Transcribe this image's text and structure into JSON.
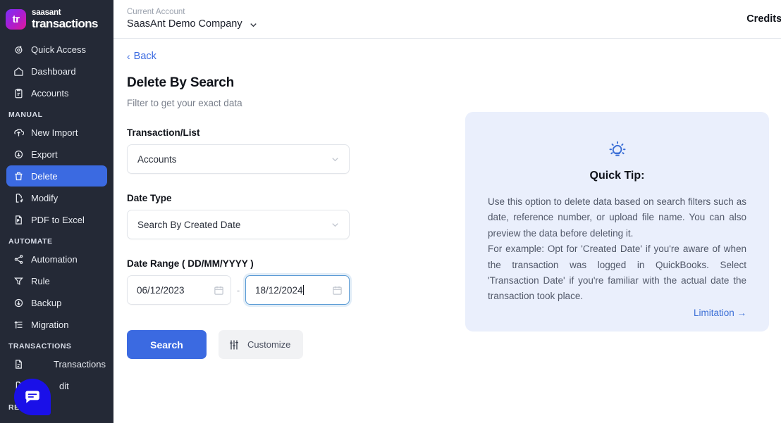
{
  "brand": {
    "mark_text": "tr",
    "name_top": "saasant",
    "name_bottom": "transactions"
  },
  "header": {
    "account_label": "Current Account",
    "account_name": "SaasAnt Demo Company",
    "credits_label": "Credits:"
  },
  "sidebar": {
    "groups": [
      {
        "label": "",
        "items": [
          {
            "label": "Quick Access",
            "icon": "target-icon",
            "active": false
          },
          {
            "label": "Dashboard",
            "icon": "home-icon",
            "active": false
          },
          {
            "label": "Accounts",
            "icon": "clipboard-icon",
            "active": false
          }
        ]
      },
      {
        "label": "MANUAL",
        "items": [
          {
            "label": "New Import",
            "icon": "upload-icon",
            "active": false
          },
          {
            "label": "Export",
            "icon": "download-icon",
            "active": false
          },
          {
            "label": "Delete",
            "icon": "trash-icon",
            "active": true
          },
          {
            "label": "Modify",
            "icon": "file-edit-icon",
            "active": false
          },
          {
            "label": "PDF to Excel",
            "icon": "pdf-file-icon",
            "active": false
          }
        ]
      },
      {
        "label": "AUTOMATE",
        "items": [
          {
            "label": "Automation",
            "icon": "share-nodes-icon",
            "active": false
          },
          {
            "label": "Rule",
            "icon": "funnel-icon",
            "active": false
          },
          {
            "label": "Backup",
            "icon": "download-cloud-icon",
            "active": false
          },
          {
            "label": "Migration",
            "icon": "list-arrow-icon",
            "active": false
          }
        ]
      },
      {
        "label": "TRANSACTIONS",
        "items": [
          {
            "label": "Transactions",
            "icon": "file-icon",
            "active": false
          },
          {
            "label": "dit",
            "icon": "file-edit-icon",
            "active": false
          }
        ]
      },
      {
        "label": "REPORTS",
        "items": []
      }
    ]
  },
  "main": {
    "back_label": "Back",
    "title": "Delete By Search",
    "subtitle": "Filter to get your exact data",
    "fields": {
      "transaction_list": {
        "label": "Transaction/List",
        "value": "Accounts"
      },
      "date_type": {
        "label": "Date Type",
        "value": "Search By Created Date"
      },
      "date_range": {
        "label": "Date Range ( DD/MM/YYYY )",
        "from_value": "06/12/2023",
        "to_value": "18/12/2024",
        "separator": "-"
      }
    },
    "buttons": {
      "search": "Search",
      "customize": "Customize"
    }
  },
  "tip": {
    "title": "Quick Tip:",
    "line1": "Use this option to delete data based on search filters such as date, reference number, or upload file name. You can also preview the data before deleting it.",
    "line2": "For example: Opt for 'Created Date' if you're aware of when the transaction was logged in QuickBooks. Select 'Transaction Date' if you're familiar with the actual date the transaction took place.",
    "link": "Limitation →"
  },
  "colors": {
    "accent": "#3b6ae1",
    "sidebar_bg": "#242936",
    "tip_bg": "#eaeffc",
    "chat_bubble": "#1a10e8"
  }
}
